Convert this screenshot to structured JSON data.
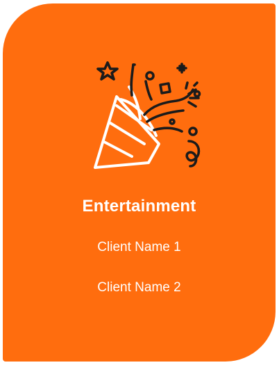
{
  "card": {
    "title": "Entertainment",
    "icon": "party-popper-icon",
    "background_color": "#ff6d0e",
    "clients": [
      "Client Name 1",
      "Client Name 2"
    ]
  }
}
